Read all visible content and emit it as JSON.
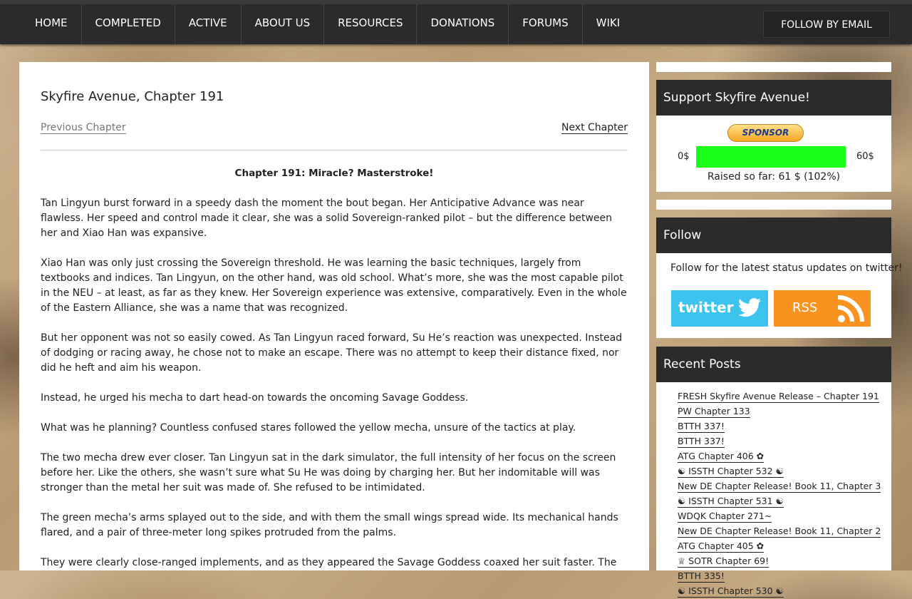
{
  "nav": {
    "items": [
      "HOME",
      "COMPLETED",
      "ACTIVE",
      "ABOUT US",
      "RESOURCES",
      "DONATIONS",
      "FORUMS",
      "WIKI"
    ],
    "follow_email": "FOLLOW BY EMAIL"
  },
  "post": {
    "title": "Skyfire Avenue, Chapter 191",
    "prev": "Previous Chapter",
    "next": "Next Chapter",
    "chapter_heading": "Chapter 191: Miracle? Masterstroke!",
    "paragraphs": [
      "Tan Lingyun burst forward in a speedy dash the moment the bout began. Her Anticipative Advance was near flawless. Her speed and control made it clear, she was a solid Sovereign-ranked pilot – but the difference between her and Xiao Han was expansive.",
      "Xiao Han was only just crossing the Sovereign threshold. He was learning the basic techniques, largely from textbooks and indices. Tan Lingyun, on the other hand, was old school. What’s more, she was the most capable pilot in the NEU – at least, as far as they knew. Her Sovereign experience was extensive, comparatively. Even in the whole of the Eastern Alliance, she was a name that was recognized.",
      "But her opponent was not so easily cowed. As Tan Lingyun raced forward, Su He’s reaction was unexpected. Instead of dodging or racing away, he chose not to make an escape. There was no attempt to keep their distance fixed, nor did he heft and aim his weapon.",
      "Instead, he urged his mecha to dart head-on towards the oncoming Savage Goddess.",
      "What was he planning? Countless confused stares followed the yellow mecha, unsure of the tactics at play.",
      "The two mecha drew ever closer. Tan Lingyun sat in the dark simulator, the full intensity of her focus on the screen before her. Like the others, she wasn’t sure what Su He was doing by charging her. But her indomitable will was stronger than the metal her suit was made of. She refused to be intimidated.",
      "The green mecha’s arms splayed out to the side, and with them the small wings spread wide. Its mechanical hands flared, and a pair of three-meter long spikes protruded from the palms.",
      "They were clearly close-ranged implements, and as they appeared the Savage Goddess coaxed her suit faster. The thrusters"
    ]
  },
  "support": {
    "title": "Support Skyfire Avenue!",
    "sponsor_label": "SPONSOR",
    "min_label": "0$",
    "max_label": "60$",
    "progress_fraction": 1.0,
    "raised_text": "Raised so far: 61 $ (102%)",
    "bar_color": "#1aff1a"
  },
  "follow": {
    "title": "Follow",
    "text": "Follow for the latest status updates on twitter!",
    "twitter_label": "twitter",
    "rss_label": "RSS",
    "twitter_color": "#3cc4ef",
    "rss_color": "#f7931e"
  },
  "recent": {
    "title": "Recent Posts",
    "items": [
      "FRESH Skyfire Avenue Release – Chapter 191",
      "PW Chapter 133",
      "BTTH 337!",
      "BTTH 337!",
      "ATG Chapter 406 ✿",
      "☯ ISSTH Chapter 532 ☯",
      "New DE Chapter Release! Book 11, Chapter 3",
      "☯ ISSTH Chapter 531 ☯",
      "WDQK Chapter 271~",
      "New DE Chapter Release! Book 11, Chapter 2",
      "ATG Chapter 405 ✿",
      "♕ SOTR Chapter 69!",
      "BTTH 335!",
      "☯ ISSTH Chapter 530 ☯"
    ]
  }
}
